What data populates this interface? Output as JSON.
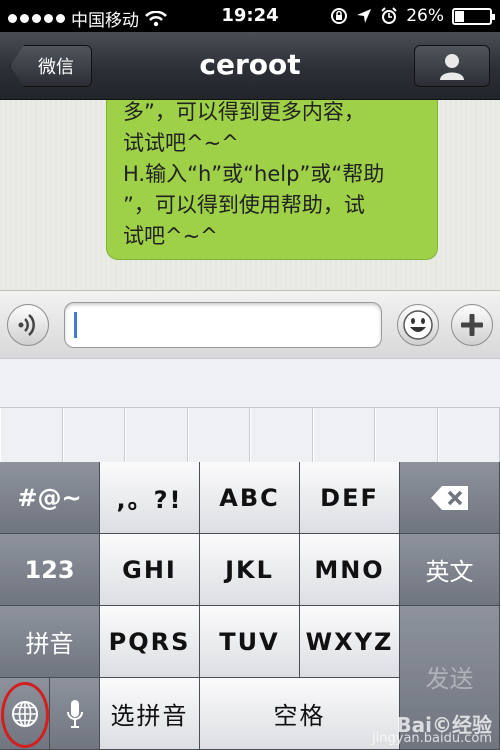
{
  "status_bar": {
    "carrier": "中国移动",
    "time": "19:24",
    "battery": "26%",
    "battery_level": 0.26,
    "icons": [
      "signal-dots-icon",
      "wifi-icon",
      "orientation-lock-icon",
      "location-arrow-icon",
      "alarm-icon",
      "battery-icon"
    ]
  },
  "nav": {
    "back_label": "微信",
    "title": "ceroot",
    "profile_icon": "person-icon"
  },
  "chat": {
    "bubble_lines": [
      "多”，可以得到更多内容，",
      "试试吧^~^",
      "H.输入“h”或“help”或“帮助",
      "”，可以得到使用帮助，试",
      "试吧^~^"
    ],
    "bubble_color": "#9ed048"
  },
  "input_bar": {
    "voice_icon": "voice-wave-icon",
    "emoji_icon": "smiley-icon",
    "plus_icon": "plus-icon",
    "value": ""
  },
  "keyboard": {
    "symbols_key": "#@~",
    "numbers_key": "123",
    "pinyin_key": "拼音",
    "k_punct": ",。?!",
    "k_abc": "ABC",
    "k_def": "DEF",
    "k_ghi": "GHI",
    "k_jkl": "JKL",
    "k_mno": "MNO",
    "k_pqrs": "PQRS",
    "k_tuv": "TUV",
    "k_wxyz": "WXYZ",
    "english_key": "英文",
    "select_pinyin_key": "选拼音",
    "space_key": "空格",
    "send_key": "发送",
    "delete_icon": "backspace-icon",
    "globe_icon": "globe-icon",
    "mic_icon": "microphone-icon"
  },
  "watermark": {
    "brand": "Bai©经验",
    "url": "jingyan.baidu.com"
  },
  "highlight_color": "#d21f1f"
}
